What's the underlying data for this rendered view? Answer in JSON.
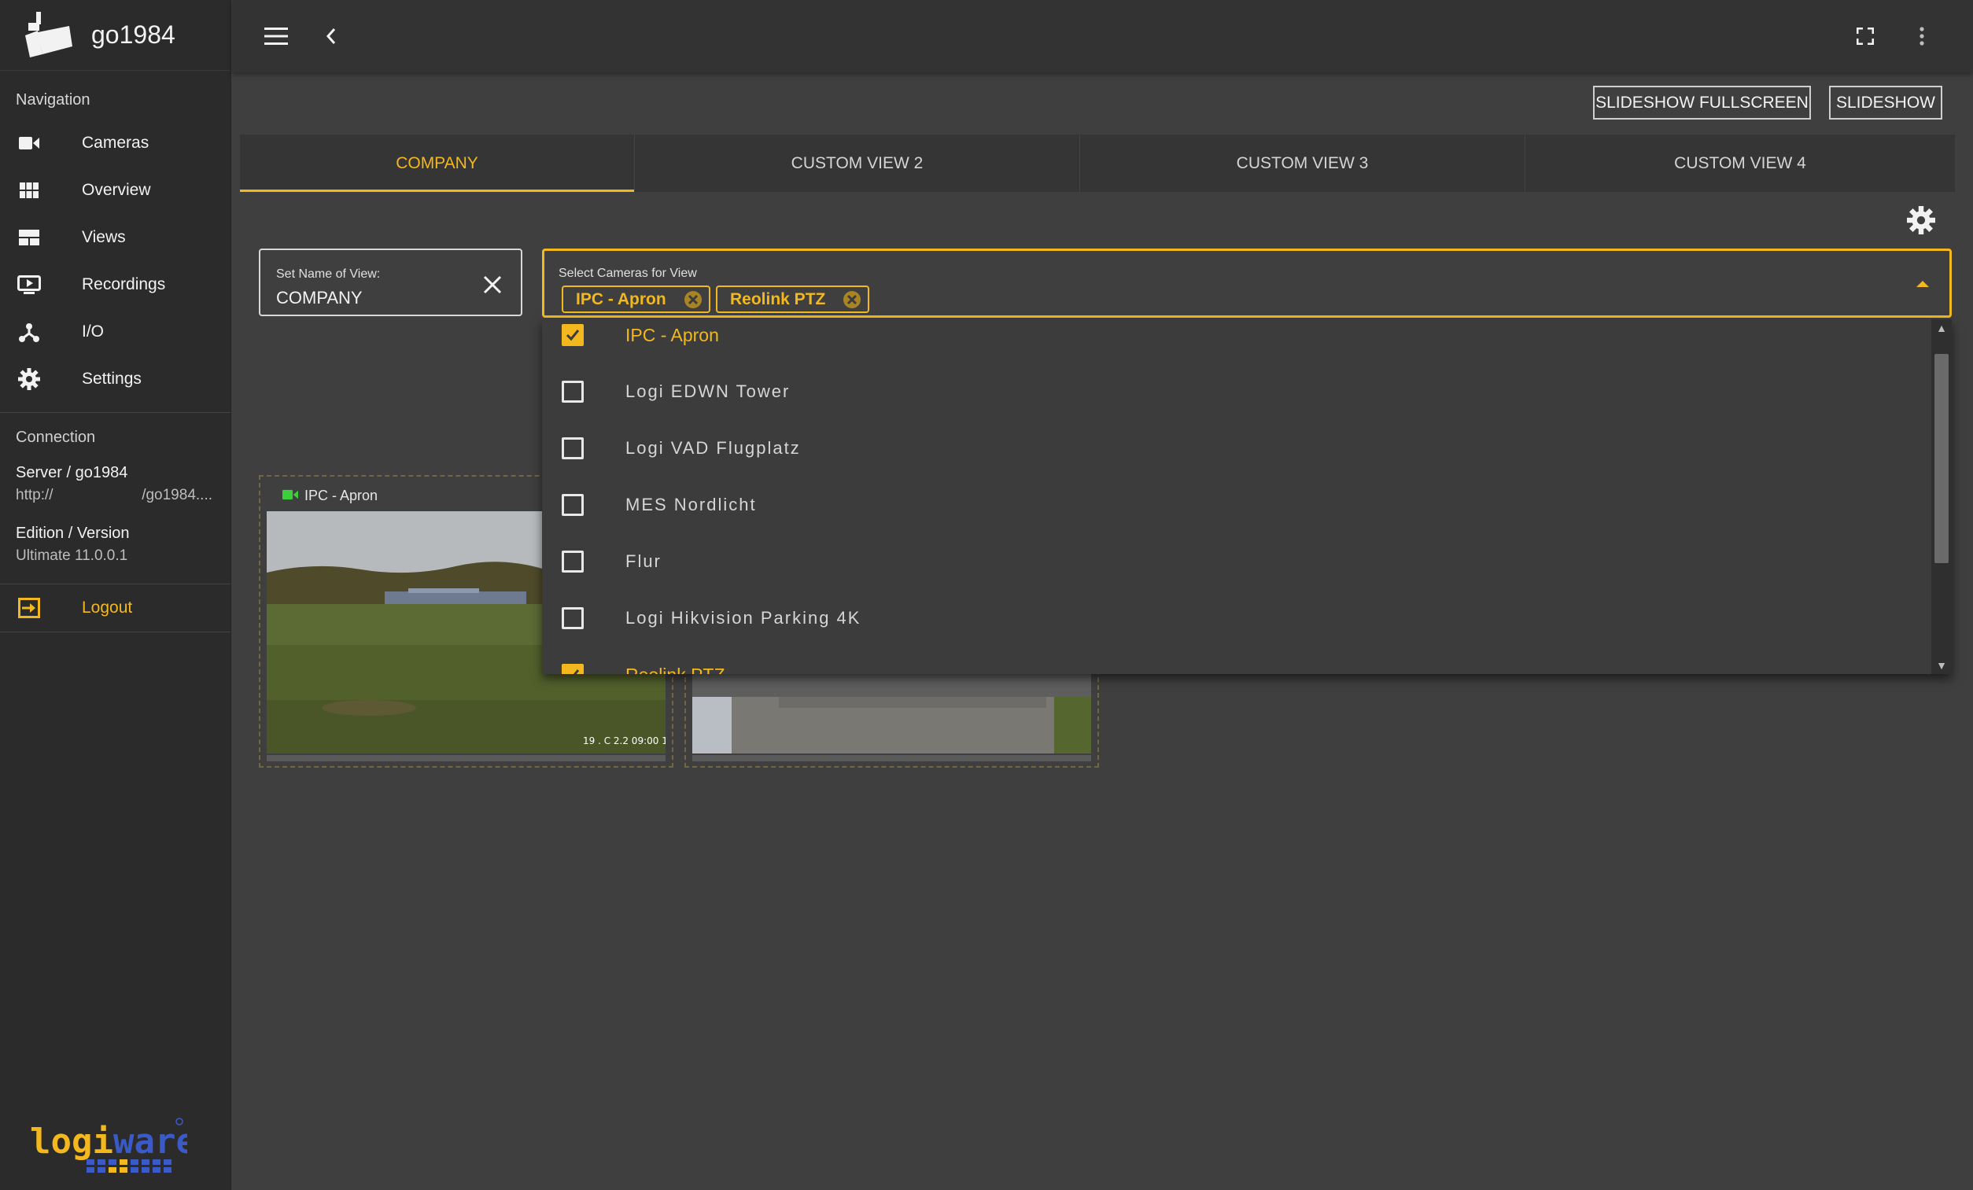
{
  "app": {
    "name": "go1984"
  },
  "sidebar": {
    "nav_title": "Navigation",
    "items": [
      {
        "label": "Cameras",
        "icon": "video-camera-icon"
      },
      {
        "label": "Overview",
        "icon": "grid-icon"
      },
      {
        "label": "Views",
        "icon": "layout-icon"
      },
      {
        "label": "Recordings",
        "icon": "play-screen-icon"
      },
      {
        "label": "I/O",
        "icon": "io-network-icon"
      },
      {
        "label": "Settings",
        "icon": "gear-icon"
      }
    ],
    "connection_title": "Connection",
    "server_label": "Server / go1984",
    "server_url_left": "http://",
    "server_url_right": "/go1984....",
    "edition_label": "Edition / Version",
    "edition_value": "Ultimate 11.0.0.1",
    "logout_label": "Logout",
    "brand_footer": "logiware"
  },
  "toolbar": {
    "slideshow_fullscreen": "SLIDESHOW FULLSCREEN",
    "slideshow": "SLIDESHOW"
  },
  "tabs": [
    {
      "label": "COMPANY",
      "active": true
    },
    {
      "label": "CUSTOM VIEW 2",
      "active": false
    },
    {
      "label": "CUSTOM VIEW 3",
      "active": false
    },
    {
      "label": "CUSTOM VIEW 4",
      "active": false
    }
  ],
  "view_name": {
    "label": "Set Name of View:",
    "value": "COMPANY"
  },
  "camera_select": {
    "label": "Select Cameras for View",
    "chips": [
      "IPC - Apron",
      "Reolink PTZ"
    ]
  },
  "dropdown": {
    "items": [
      {
        "label": "IPC - Apron",
        "checked": true
      },
      {
        "label": "Logi  EDWN Tower",
        "checked": false
      },
      {
        "label": "Logi VAD Flugplatz",
        "checked": false
      },
      {
        "label": "MES Nordlicht",
        "checked": false
      },
      {
        "label": "Flur",
        "checked": false
      },
      {
        "label": "Logi  Hikvision Parking 4K",
        "checked": false
      },
      {
        "label": "Reolink PTZ",
        "checked": true
      }
    ]
  },
  "tiles": [
    {
      "title": "IPC - Apron",
      "timestamp": "19 . C 2.2  09:00 1"
    }
  ],
  "colors": {
    "accent": "#f2b81e",
    "sidebar": "#2b2b2b",
    "content": "#3f3f3f",
    "live": "#3ccf3c"
  }
}
